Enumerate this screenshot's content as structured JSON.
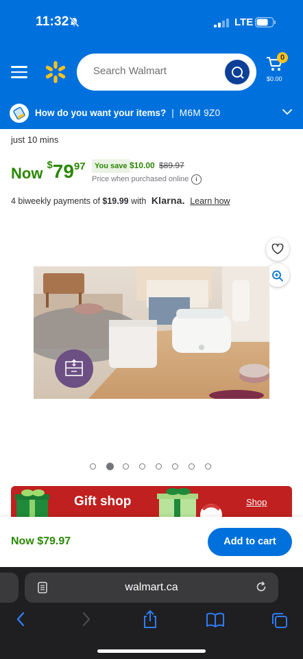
{
  "status_bar": {
    "time": "11:32",
    "network": "LTE"
  },
  "header": {
    "search_placeholder": "Search Walmart",
    "cart_count": "0",
    "cart_total": "$0.00",
    "delivery_prompt": "How do you want your items?",
    "delivery_separator": "|",
    "postal_code": "M6M 9Z0"
  },
  "product": {
    "lead_text": "just 10 mins",
    "now_label": "Now",
    "price_dollar_sign": "$",
    "price_int": "79",
    "price_cents": "97",
    "you_save_label": "You save",
    "save_amount": "$10.00",
    "was_price": "$89.97",
    "price_note": "Price when purchased online",
    "installments_prefix": "4 biweekly payments of ",
    "installment_amount": "$19.99",
    "installments_with": " with ",
    "klarna_brand": "Klarna.",
    "learn_how": "Learn how"
  },
  "carousel": {
    "count": 8,
    "active_index": 1
  },
  "promo": {
    "title": "Gift shop",
    "link": "Shop"
  },
  "sticky_bar": {
    "price": "Now $79.97",
    "add_to_cart": "Add to cart"
  },
  "browser": {
    "url": "walmart.ca"
  },
  "colors": {
    "brand_blue": "#0071dc",
    "price_green": "#2a8703",
    "spark_yellow": "#ffc220",
    "promo_red": "#c0201f"
  }
}
